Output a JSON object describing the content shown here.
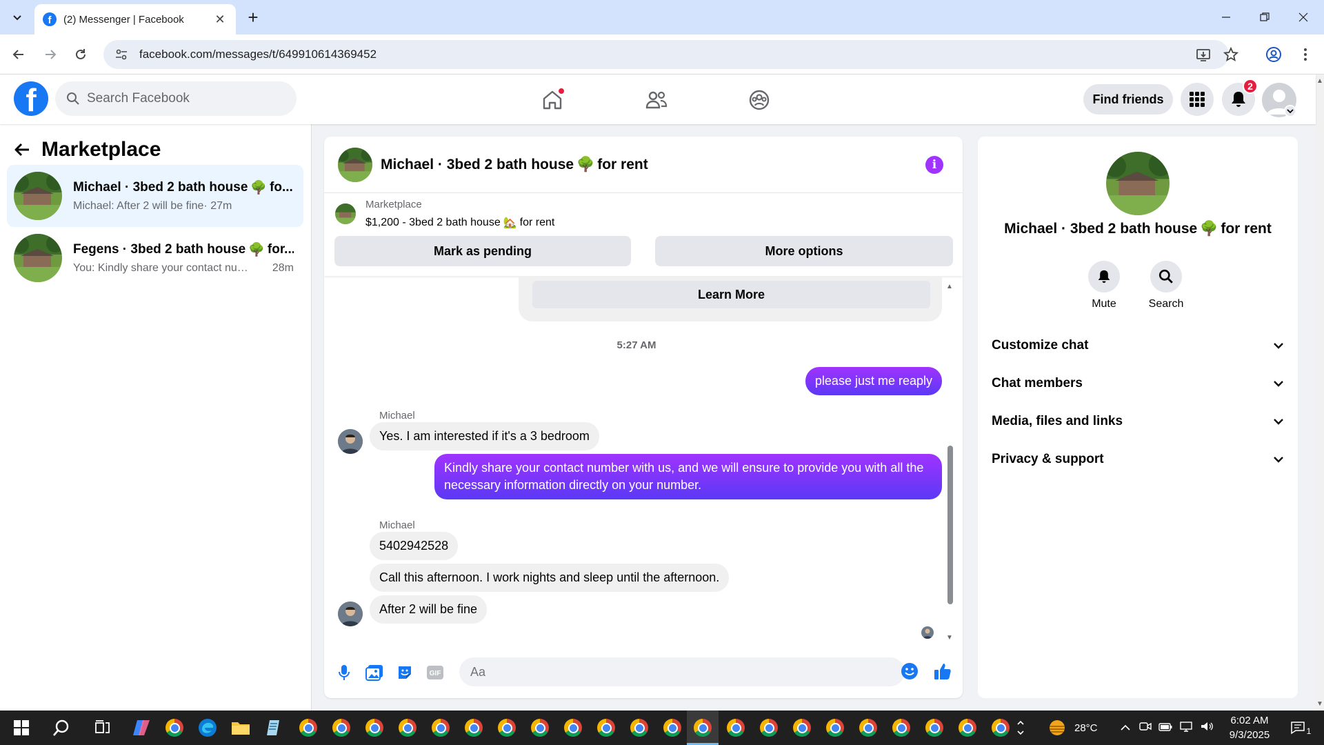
{
  "browser": {
    "tab_title": "(2) Messenger | Facebook",
    "url": "facebook.com/messages/t/649910614369452"
  },
  "fb": {
    "search_placeholder": "Search Facebook",
    "find_friends": "Find friends",
    "notification_count": "2"
  },
  "left_panel": {
    "title": "Marketplace",
    "conversations": [
      {
        "name": "Michael · 3bed 2 bath house",
        "name_tail": " fo...",
        "snippet": "Michael: After 2 will be fine",
        "time": " · 27m",
        "active": true
      },
      {
        "name": "Fegens · 3bed 2 bath house",
        "name_tail": " for...",
        "snippet": "You: Kindly share your contact num...",
        "time": "28m",
        "active": false
      }
    ]
  },
  "chat": {
    "title": "Michael · 3bed 2 bath house",
    "title_tail": " for rent",
    "listing": {
      "source": "Marketplace",
      "price_title": "$1,200 - 3bed 2 bath house",
      "price_tail": " for rent",
      "mark_pending": "Mark as pending",
      "more_options": "More options"
    },
    "learn_more": "Learn More",
    "timestamp": "5:27 AM",
    "messages": [
      {
        "dir": "out",
        "text": "please just me reaply"
      },
      {
        "dir": "in",
        "sender": "Michael",
        "text": "Yes. I am interested if it's a 3 bedroom"
      },
      {
        "dir": "out",
        "text": "Kindly share your contact number with us, and we will ensure to provide you with all the necessary information directly on your number."
      },
      {
        "dir": "in",
        "sender": "Michael",
        "text": "5402942528"
      },
      {
        "dir": "in",
        "text": "Call this afternoon. I work nights and sleep until the afternoon."
      },
      {
        "dir": "in",
        "text": "After 2 will be fine"
      }
    ],
    "composer_placeholder": "Aa"
  },
  "right_panel": {
    "name": "Michael · 3bed 2 bath house",
    "name_tail": " for rent",
    "actions": [
      "Mute",
      "Search"
    ],
    "sections": [
      "Customize chat",
      "Chat members",
      "Media, files and links",
      "Privacy & support"
    ]
  },
  "taskbar": {
    "temperature": "28°C",
    "time": "6:02 AM",
    "date": "9/3/2025",
    "notifications": "1"
  },
  "colors": {
    "fb_blue": "#1877f2",
    "messenger_purple": "#a033ff",
    "active_row": "#ebf5ff"
  }
}
